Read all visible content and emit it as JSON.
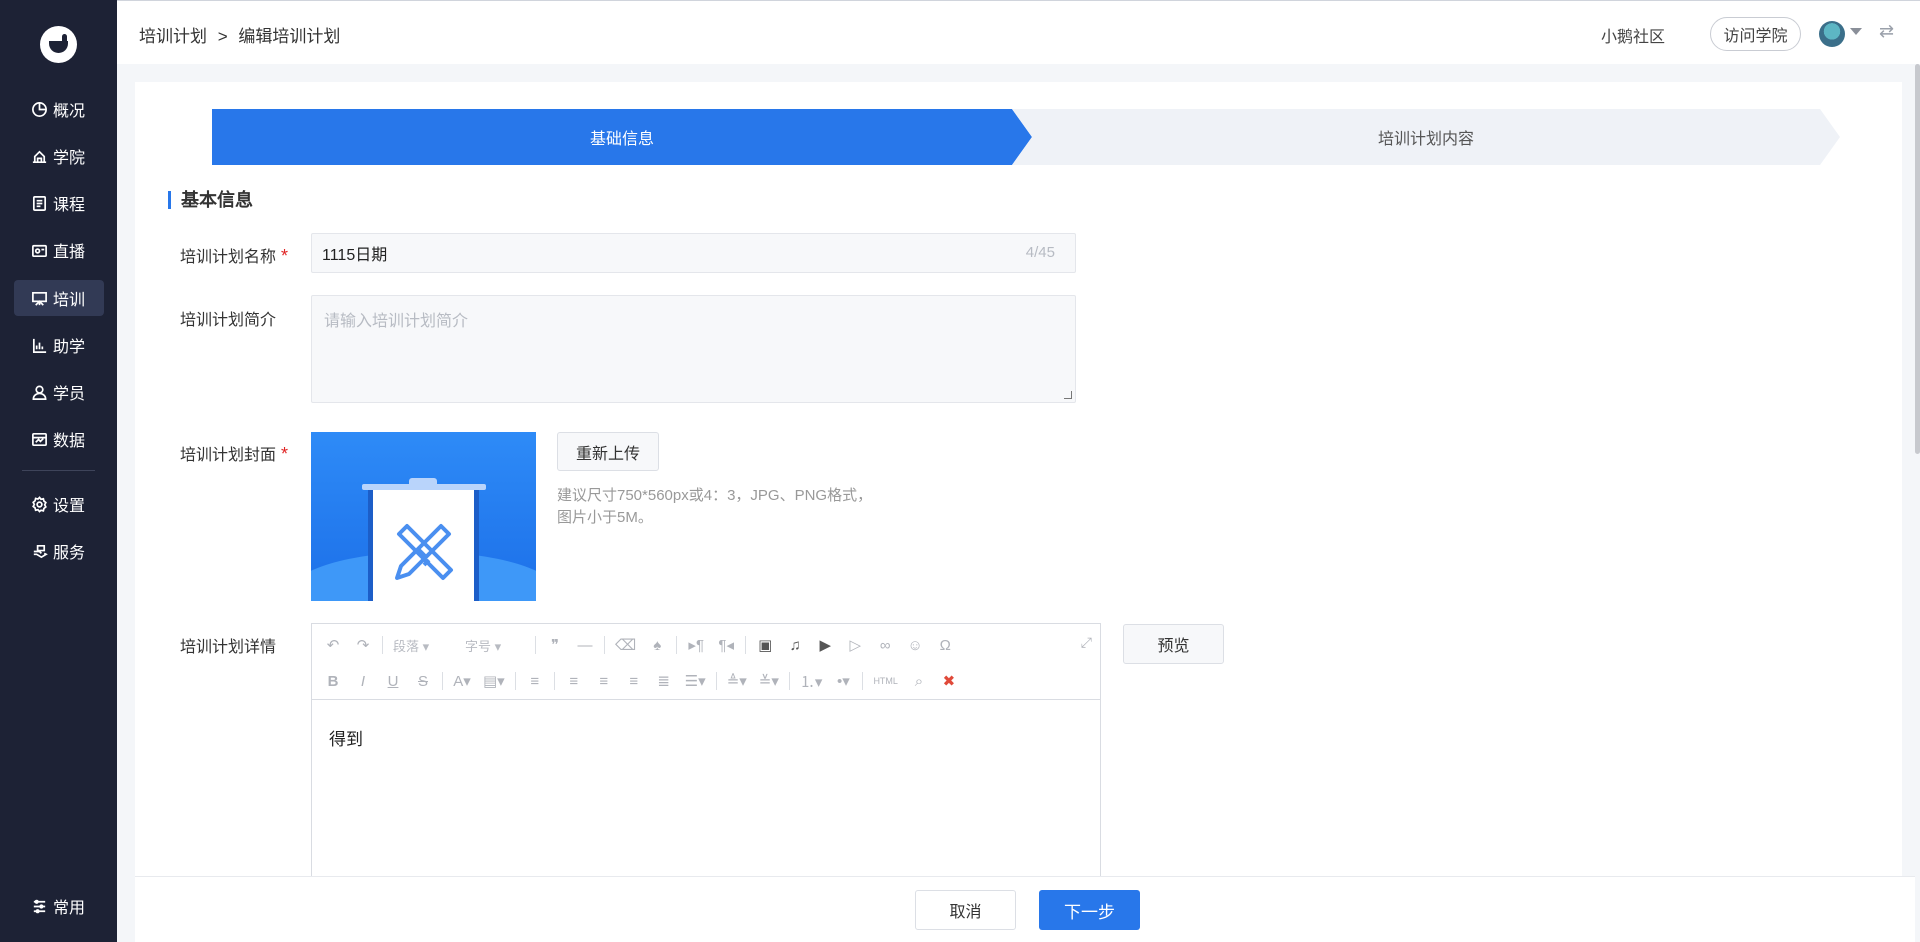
{
  "sidebar": {
    "items": [
      {
        "label": "概况",
        "icon": "pie-chart-icon"
      },
      {
        "label": "学院",
        "icon": "academy-icon"
      },
      {
        "label": "课程",
        "icon": "course-icon"
      },
      {
        "label": "直播",
        "icon": "live-icon"
      },
      {
        "label": "培训",
        "icon": "training-icon",
        "active": true
      },
      {
        "label": "助学",
        "icon": "chart-icon"
      },
      {
        "label": "学员",
        "icon": "user-icon"
      },
      {
        "label": "数据",
        "icon": "data-icon"
      },
      {
        "label": "设置",
        "icon": "gear-icon"
      },
      {
        "label": "服务",
        "icon": "service-icon"
      }
    ],
    "bottom": {
      "label": "常用",
      "icon": "list-icon"
    }
  },
  "header": {
    "breadcrumb": [
      "培训计划",
      ">",
      "编辑培训计划"
    ],
    "community": "小鹅社区",
    "visit_button": "访问学院"
  },
  "steps": [
    {
      "label": "基础信息",
      "active": true
    },
    {
      "label": "培训计划内容",
      "active": false
    }
  ],
  "form": {
    "section_title": "基本信息",
    "name": {
      "label": "培训计划名称",
      "required": "*",
      "value": "1115日期",
      "counter": "4/45"
    },
    "intro": {
      "label": "培训计划简介",
      "placeholder": "请输入培训计划简介"
    },
    "cover": {
      "label": "培训计划封面",
      "required": "*",
      "reupload": "重新上传",
      "hint_line1": "建议尺寸750*560px或4：3，JPG、PNG格式，",
      "hint_line2": "图片小于5M。"
    },
    "detail": {
      "label": "培训计划详情",
      "paragraph_dropdown": "段落",
      "fontsize_dropdown": "字号",
      "html_label": "HTML",
      "content": "得到",
      "preview": "预览"
    }
  },
  "footer": {
    "cancel": "取消",
    "next": "下一步"
  },
  "colors": {
    "sidebar_bg": "#1d2235",
    "primary": "#2877ea",
    "required": "#e02424"
  }
}
